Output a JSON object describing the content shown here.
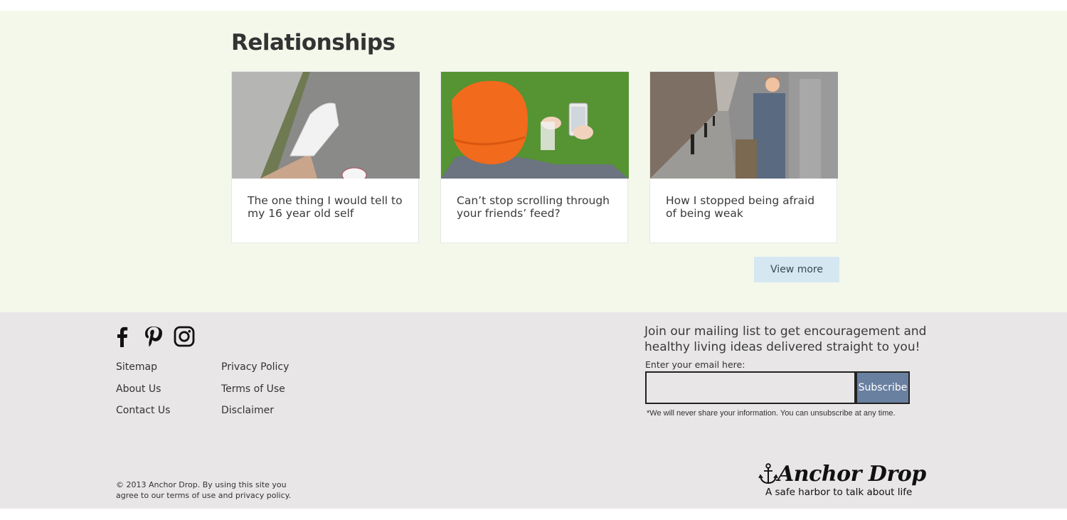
{
  "section": {
    "title": "Relationships",
    "cards": [
      {
        "title": "The one thing I would tell to my 16 year old self"
      },
      {
        "title": "Can’t stop scrolling through your friends’ feed?"
      },
      {
        "title": "How I stopped being afraid of being weak"
      }
    ],
    "view_more_label": "View more"
  },
  "footer": {
    "social": [
      {
        "icon": "facebook-icon"
      },
      {
        "icon": "pinterest-icon"
      },
      {
        "icon": "instagram-icon"
      }
    ],
    "links_col1": [
      "Sitemap",
      "About Us",
      "Contact Us"
    ],
    "links_col2": [
      "Privacy Policy",
      "Terms of Use",
      "Disclaimer"
    ],
    "copyright": "© 2013 Anchor Drop. By using this site you agree to our terms of use and privacy policy.",
    "mailing": {
      "heading": "Join our mailing list to get encouragement and healthy living ideas delivered straight to you!",
      "email_label": "Enter your email here:",
      "email_value": "",
      "subscribe_label": "Subscribe",
      "note": "*We will never share your information. You can unsubscribe at any time."
    },
    "logo": {
      "brand": "Anchor Drop",
      "tagline": "A safe harbor to talk about life"
    }
  },
  "colors": {
    "section_bg": "#f4f8eb",
    "footer_bg": "#e8e6e7",
    "view_more_bg": "#d5e7f1",
    "subscribe_bg": "#6a80a0"
  }
}
